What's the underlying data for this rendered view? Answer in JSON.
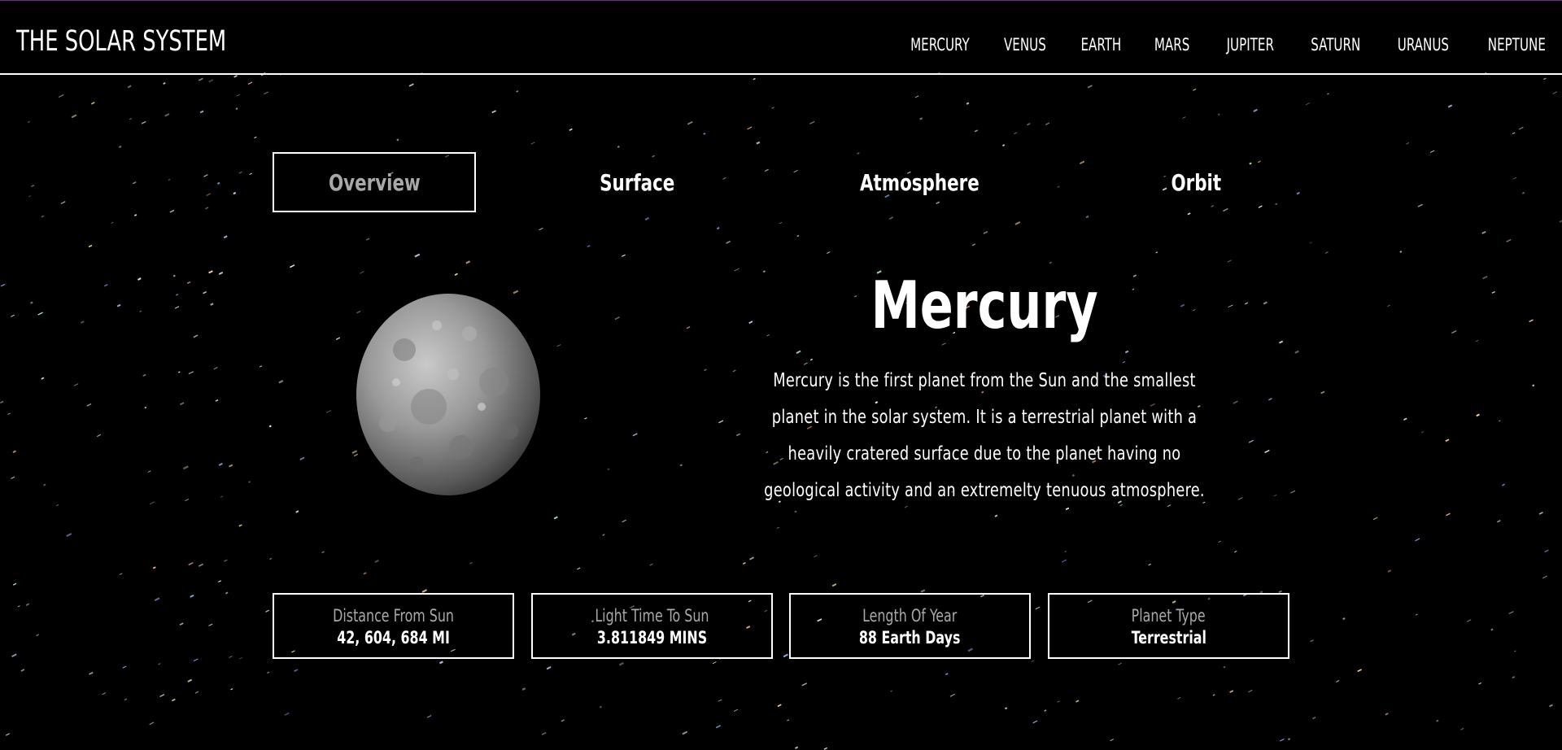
{
  "header": {
    "logo": "THE SOLAR SYSTEM",
    "nav": [
      "MERCURY",
      "VENUS",
      "EARTH",
      "MARS",
      "JUPITER",
      "SATURN",
      "URANUS",
      "NEPTUNE"
    ]
  },
  "tabs": [
    {
      "label": "Overview",
      "active": true
    },
    {
      "label": "Surface",
      "active": false
    },
    {
      "label": "Atmosphere",
      "active": false
    },
    {
      "label": "Orbit",
      "active": false
    }
  ],
  "planet": {
    "name": "Mercury",
    "description": "Mercury is the first planet from the Sun and the smallest planet in the solar system. It is a terrestrial planet with a heavily cratered surface due to the planet having no geological activity and an extremelty tenuous atmosphere."
  },
  "stats": [
    {
      "label": "Distance From Sun",
      "value": "42, 604, 684 MI"
    },
    {
      "label": "Light Time To Sun",
      "value": "3.811849 MINS"
    },
    {
      "label": "Length Of Year",
      "value": "88 Earth Days"
    },
    {
      "label": "Planet Type",
      "value": "Terrestrial"
    }
  ],
  "colors": {
    "background": "#000000",
    "text": "#ffffff",
    "muted": "#a9a9a9",
    "border": "#ffffff"
  }
}
